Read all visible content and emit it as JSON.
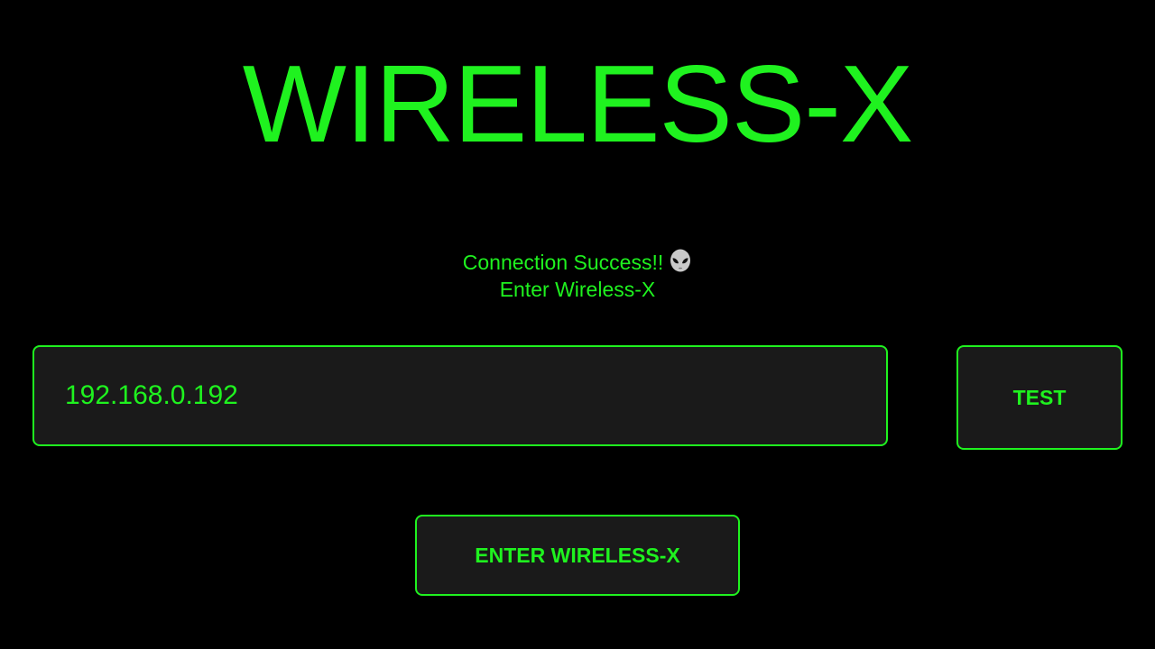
{
  "app": {
    "title": "WIRELESS-X"
  },
  "status": {
    "line1": "Connection Success!!",
    "line2": "Enter Wireless-X",
    "icon": "alien-icon"
  },
  "ip_input": {
    "value": "192.168.0.192",
    "placeholder": ""
  },
  "buttons": {
    "test_label": "TEST",
    "enter_label": "ENTER WIRELESS-X"
  },
  "colors": {
    "background": "#000000",
    "accent": "#1ff21f",
    "field_background": "#1a1a1a"
  }
}
